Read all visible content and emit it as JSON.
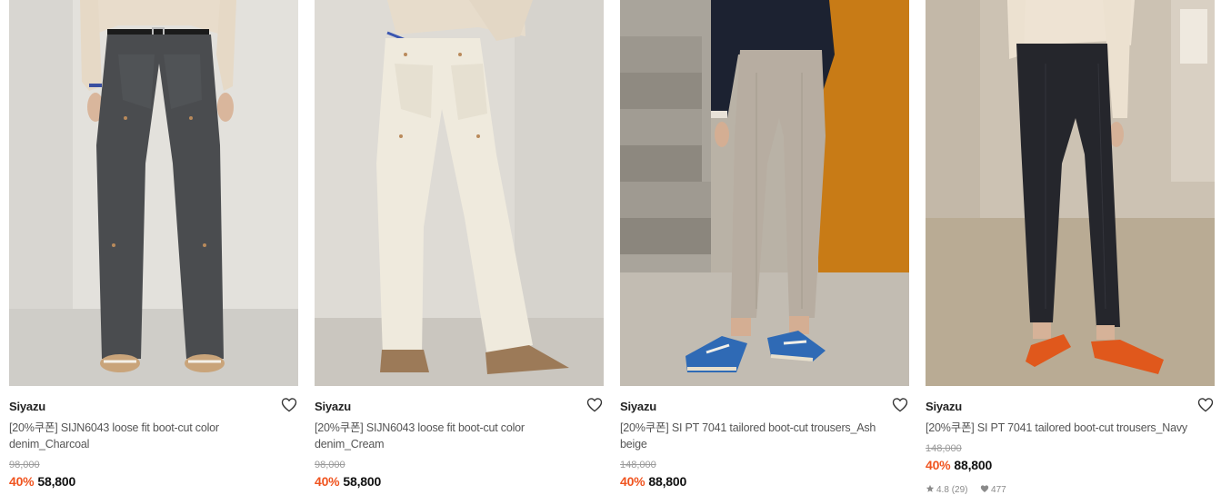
{
  "products": [
    {
      "brand": "Siyazu",
      "title": "[20%쿠폰] SIJN6043 loose fit boot-cut color denim_Charcoal",
      "original_price": "98,000",
      "discount": "40%",
      "price": "58,800",
      "image": "charcoal-denim-photo"
    },
    {
      "brand": "Siyazu",
      "title": "[20%쿠폰] SIJN6043 loose fit boot-cut color denim_Cream",
      "original_price": "98,000",
      "discount": "40%",
      "price": "58,800",
      "image": "cream-denim-photo"
    },
    {
      "brand": "Siyazu",
      "title": "[20%쿠폰] SI PT 7041 tailored boot-cut trousers_Ash beige",
      "original_price": "148,000",
      "discount": "40%",
      "price": "88,800",
      "image": "ash-beige-trousers-photo"
    },
    {
      "brand": "Siyazu",
      "title": "[20%쿠폰] SI PT 7041 tailored boot-cut trousers_Navy",
      "original_price": "148,000",
      "discount": "40%",
      "price": "88,800",
      "rating": "4.8",
      "review_count": "(29)",
      "likes": "477",
      "image": "navy-trousers-photo"
    }
  ],
  "icons": {
    "wishlist": "heart-outline-icon",
    "rating": "star-icon",
    "likes": "heart-filled-icon"
  },
  "colors": {
    "discount": "#f0541f",
    "price": "#111111",
    "brand": "#222222"
  }
}
